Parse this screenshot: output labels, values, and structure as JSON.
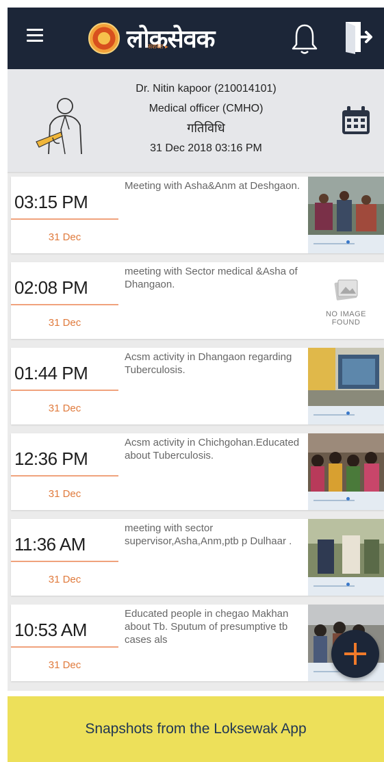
{
  "app": {
    "logo_text": "लोकसेवक",
    "logo_tag": "सशक्त ▸",
    "colors": {
      "appbar": "#1c2638",
      "accent": "#e07a3c",
      "fab_plus": "#f07a2a",
      "caption_bg": "#ede05a"
    },
    "icons": [
      "menu-icon",
      "emblem-icon",
      "bell-icon",
      "logout-icon",
      "doctor-icon",
      "calendar-icon",
      "no-image-icon",
      "plus-icon"
    ]
  },
  "profile": {
    "name": "Dr. Nitin kapoor (210014101)",
    "role": "Medical officer (CMHO)",
    "section": "गतिविधि",
    "datetime": "31 Dec 2018 03:16 PM"
  },
  "activities": [
    {
      "time": "03:15 PM",
      "date": "31 Dec",
      "desc": "Meeting with Asha&Anm at Deshgaon.",
      "has_image": true
    },
    {
      "time": "02:08 PM",
      "date": "31 Dec",
      "desc": "meeting with Sector medical &Asha of Dhangaon.",
      "has_image": false
    },
    {
      "time": "01:44 PM",
      "date": "31 Dec",
      "desc": "Acsm activity in Dhangaon regarding Tuberculosis.",
      "has_image": true
    },
    {
      "time": "12:36 PM",
      "date": "31 Dec",
      "desc": "Acsm activity in Chichgohan.Educated about Tuberculosis.",
      "has_image": true
    },
    {
      "time": "11:36 AM",
      "date": "31 Dec",
      "desc": "meeting with sector supervisor,Asha,Anm,ptb p Dulhaar .",
      "has_image": true
    },
    {
      "time": "10:53 AM",
      "date": "31 Dec",
      "desc": "Educated people in chegao Makhan about Tb. Sputum of presumptive tb cases als",
      "has_image": true
    }
  ],
  "no_image": {
    "line1": "NO IMAGE",
    "line2": "FOUND"
  },
  "caption": "Snapshots from the Loksewak App"
}
